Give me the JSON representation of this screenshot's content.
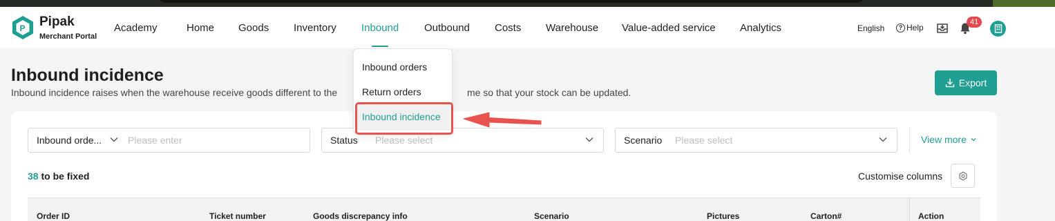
{
  "brand": {
    "name": "Pipak",
    "subtitle": "Merchant Portal"
  },
  "nav": {
    "items": [
      "Academy",
      "Home",
      "Goods",
      "Inventory",
      "Inbound",
      "Outbound",
      "Costs",
      "Warehouse",
      "Value-added service",
      "Analytics"
    ],
    "active": "Inbound",
    "language": "English",
    "help": "Help",
    "notification_count": "41"
  },
  "dropdown": {
    "items": [
      "Inbound orders",
      "Return orders",
      "Inbound incidence"
    ],
    "active": "Inbound incidence"
  },
  "page": {
    "title": "Inbound incidence",
    "description": "Inbound incidence raises when the warehouse receive goods different to the",
    "description_tail": "me so that your stock can be updated.",
    "export_label": "Export"
  },
  "filters": {
    "order_field_label": "Inbound orde...",
    "order_placeholder": "Please enter",
    "status_label": "Status",
    "status_placeholder": "Please select",
    "scenario_label": "Scenario",
    "scenario_placeholder": "Please select",
    "view_more": "View more"
  },
  "summary": {
    "count": "38",
    "count_text": "to be fixed",
    "customise_label": "Customise columns"
  },
  "table": {
    "columns": [
      "Order ID",
      "Ticket number",
      "Goods discrepancy info",
      "Scenario",
      "Pictures",
      "Carton#",
      "Action"
    ]
  },
  "colors": {
    "accent": "#1f9e92",
    "annotation": "#e8524f",
    "badge": "#e5484d"
  },
  "icons": [
    "logo-icon",
    "help-icon",
    "download-tray-icon",
    "bell-icon",
    "avatar-icon",
    "export-icon",
    "chevron-down-icon",
    "gear-icon",
    "arrow-annotation-icon"
  ]
}
